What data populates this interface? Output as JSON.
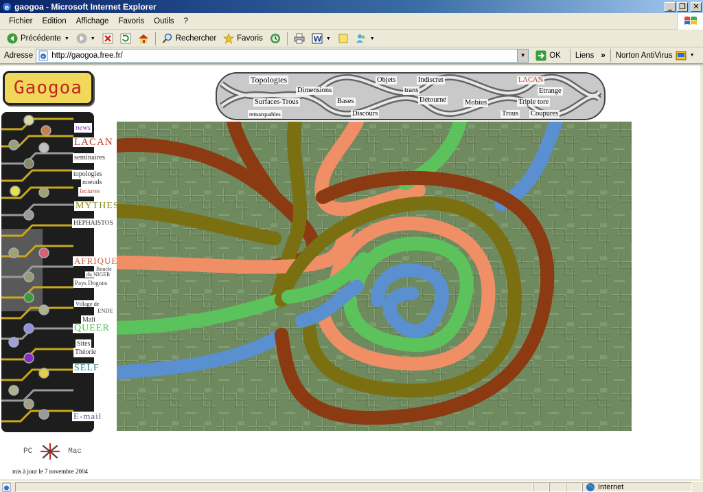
{
  "window": {
    "title": "gaogoa - Microsoft Internet Explorer",
    "minimize": "_",
    "restore": "❐",
    "close": "✕"
  },
  "menu": [
    "Fichier",
    "Edition",
    "Affichage",
    "Favoris",
    "Outils",
    "?"
  ],
  "toolbar": {
    "back": "Précédente",
    "search": "Rechercher",
    "favorites": "Favoris"
  },
  "address": {
    "label": "Adresse",
    "url": "http://gaogoa.free.fr/",
    "go": "OK",
    "links": "Liens",
    "links_more": "»",
    "antivirus": "Norton AntiVirus"
  },
  "site": {
    "logo": "Gaogoa",
    "braid_links": [
      "Topologies",
      "Dimensions",
      "Surfaces-Trous",
      "remarquables",
      "Bases",
      "Discours",
      "Objets",
      "trans",
      "Indiscret",
      "Détourné",
      "Mobius",
      "LACAN",
      "Etrange",
      "Triple tore",
      "Trous",
      "Coupures"
    ],
    "nav": [
      "news",
      "LACAN",
      "seminaires",
      "topologies",
      "noeuds",
      "lectures",
      "MYTHES",
      "HEPHAISTOS",
      "AFRIQUE",
      "Boucle",
      "du NIGER",
      "Pays Dogons",
      "Village de",
      "ENDE",
      "Mali",
      "QUEER",
      "Sites",
      "Théorie",
      "SELF",
      "E-mail"
    ],
    "os_pc": "PC",
    "os_mac": "Mac",
    "updated": "mis à jour le 7 novembre 2004"
  },
  "status": {
    "zone": "Internet"
  },
  "colors": {
    "title_bar": "#0a246a",
    "logo_bg": "#f0d85a",
    "logo_text": "#c62424",
    "art_bg": "#6f8a5f"
  }
}
